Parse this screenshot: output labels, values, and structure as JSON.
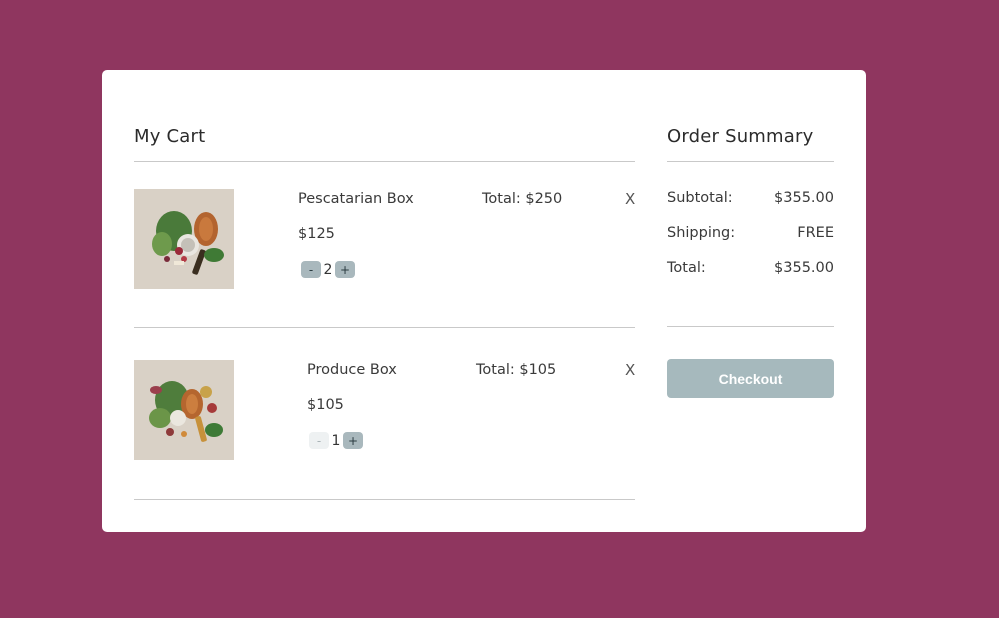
{
  "cart": {
    "title": "My Cart",
    "items": [
      {
        "name": "Pescatarian Box",
        "price": "$125",
        "total": "Total: $250",
        "remove": "X",
        "quantity": "2",
        "decrement": "-",
        "increment": "+"
      },
      {
        "name": "Produce Box",
        "price": "$105",
        "total": "Total: $105",
        "remove": "X",
        "quantity": "1",
        "decrement": "-",
        "increment": "+"
      }
    ]
  },
  "summary": {
    "title": "Order Summary",
    "subtotal_label": "Subtotal:",
    "subtotal_value": "$355.00",
    "shipping_label": "Shipping:",
    "shipping_value": "FREE",
    "total_label": "Total:",
    "total_value": "$355.00",
    "checkout_label": "Checkout"
  },
  "colors": {
    "background": "#8f365f",
    "card": "#ffffff",
    "accent": "#a6b9bd"
  }
}
